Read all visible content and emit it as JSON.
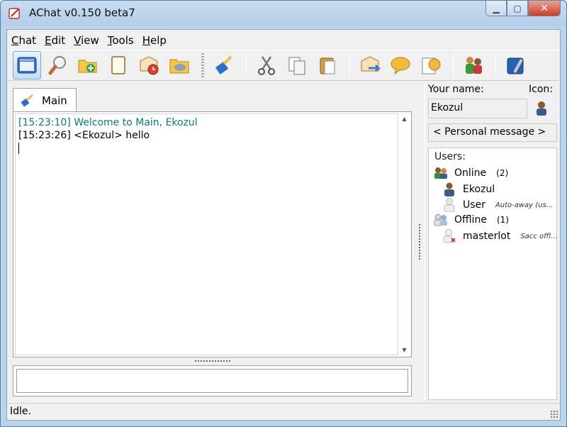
{
  "window": {
    "title": "AChat v0.150 beta7"
  },
  "menu": [
    {
      "key": "C",
      "rest": "hat"
    },
    {
      "key": "E",
      "rest": "dit"
    },
    {
      "key": "V",
      "rest": "iew"
    },
    {
      "key": "T",
      "rest": "ools"
    },
    {
      "key": "H",
      "rest": "elp"
    }
  ],
  "toolbar": {
    "icons": [
      "main-window-icon",
      "search-icon",
      "add-folder-icon",
      "new-doc-icon",
      "mail-clock-icon",
      "folder-icon",
      "clear-brush-icon",
      "cut-icon",
      "copy-icon",
      "paste-icon",
      "send-icon",
      "chat-bubble-icon",
      "emoticon-icon",
      "users-icon",
      "settings-icon"
    ]
  },
  "tabs": [
    {
      "label": "Main"
    }
  ],
  "chat": {
    "lines": [
      {
        "text": "[15:23:10] Welcome to Main, Ekozul",
        "kind": "system"
      },
      {
        "text": "[15:23:26] <Ekozul> hello",
        "kind": "message"
      }
    ]
  },
  "input": {
    "value": ""
  },
  "profile": {
    "name_label": "Your name:",
    "icon_label": "Icon:",
    "name_value": "Ekozul",
    "personal_message": "< Personal message >"
  },
  "users": {
    "label": "Users:",
    "online": {
      "label": "Online",
      "count": "(2)"
    },
    "offline": {
      "label": "Offline",
      "count": "(1)"
    },
    "online_users": [
      {
        "name": "Ekozul",
        "status": ""
      },
      {
        "name": "User",
        "status": "Auto-away (us..."
      }
    ],
    "offline_users": [
      {
        "name": "masterlot",
        "status": "Sacc offl..."
      }
    ]
  },
  "status": {
    "text": "Idle."
  },
  "colors": {
    "system_text": "#0a7b7b",
    "titlebar": "#b4cde9",
    "close_button": "#c7402a"
  }
}
